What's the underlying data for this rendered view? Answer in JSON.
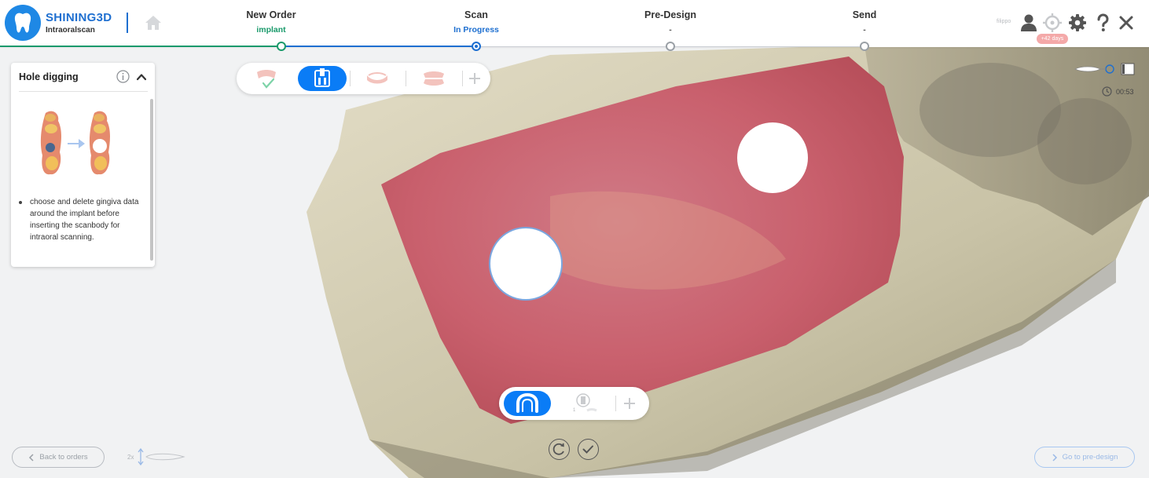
{
  "app": {
    "brand": "SHINING3D",
    "product": "Intraoralscan"
  },
  "steps": [
    {
      "title": "New Order",
      "status": "implant",
      "status_color": "#1a9a6b",
      "state": "done"
    },
    {
      "title": "Scan",
      "status": "In Progress",
      "status_color": "#1e6fd0",
      "state": "current"
    },
    {
      "title": "Pre-Design",
      "status": "-",
      "status_color": "#555555",
      "state": "pending"
    },
    {
      "title": "Send",
      "status": "-",
      "status_color": "#555555",
      "state": "pending"
    }
  ],
  "header_right": {
    "user": "filippo",
    "days_badge": "+42 days",
    "icons": [
      "user-icon",
      "target-icon",
      "gear-icon",
      "help-icon",
      "close-icon"
    ]
  },
  "help_panel": {
    "title": "Hole digging",
    "description": "choose and delete gingiva data around the implant before inserting the scanbody for intraoral scanning."
  },
  "top_toolbar": {
    "items": [
      "upper-jaw-done-icon",
      "implant-scanbody-icon",
      "lower-jaw-icon",
      "bite-icon",
      "add-icon"
    ],
    "active": "implant-scanbody-icon"
  },
  "bottom_toolbar": {
    "items": [
      "arch-icon",
      "scanbody-icon",
      "add-icon"
    ],
    "active": "arch-icon",
    "scanbody_count": "1"
  },
  "indicators": {
    "timer": "00:53"
  },
  "footer": {
    "back": "Back to orders",
    "next": "Go to pre-design",
    "zoom": "2x"
  },
  "colors": {
    "accent": "#0a7cf6",
    "progress_done": "#1a9a6b",
    "progress_current": "#1e6fd0",
    "gingiva": "#d56f78",
    "stone_model": "#d9d2b8"
  }
}
